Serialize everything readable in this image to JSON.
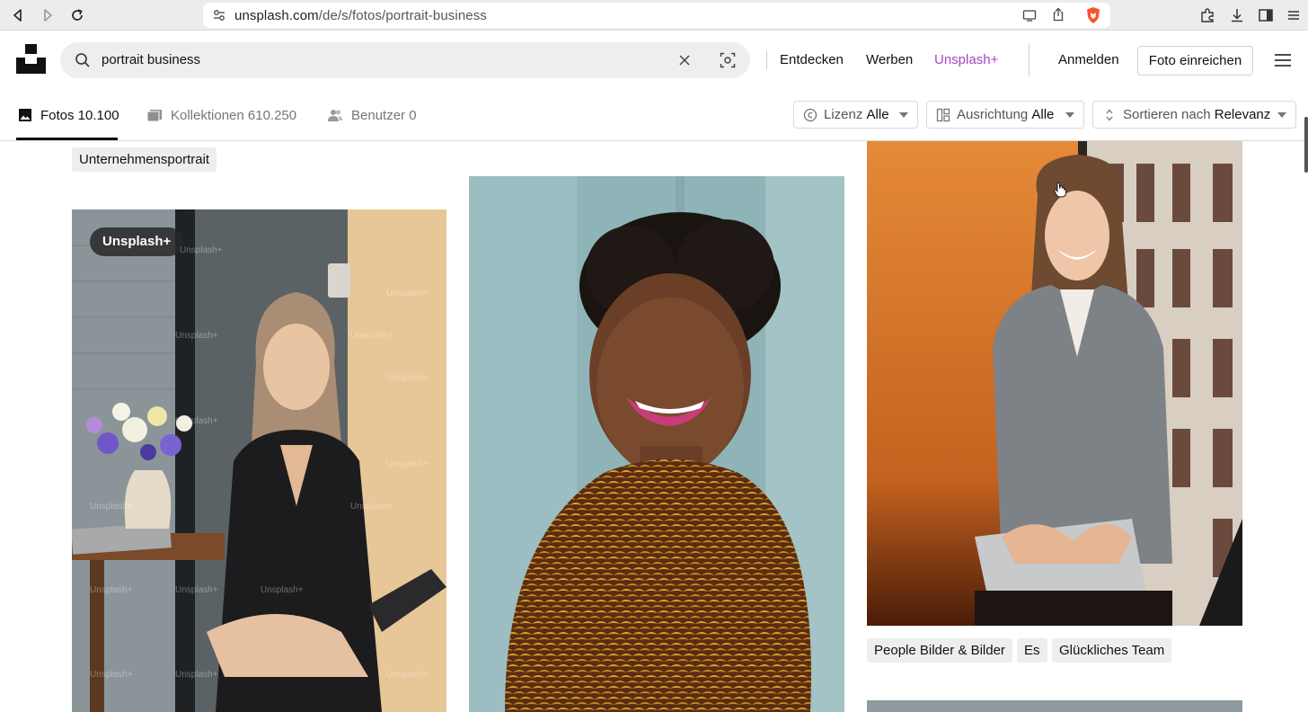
{
  "browser": {
    "url_host": "unsplash.com",
    "url_path": "/de/s/fotos/portrait-business"
  },
  "header": {
    "search_value": "portrait business",
    "nav": {
      "explore": "Entdecken",
      "advertise": "Werben",
      "plus": "Unsplash+",
      "login": "Anmelden",
      "submit": "Foto einreichen"
    }
  },
  "tabs": [
    {
      "label": "Fotos 10.100"
    },
    {
      "label": "Kollektionen 610.250"
    },
    {
      "label": "Benutzer 0"
    }
  ],
  "filters": {
    "license": {
      "label": "Lizenz",
      "value": "Alle"
    },
    "orientation": {
      "label": "Ausrichtung",
      "value": "Alle"
    },
    "sort": {
      "label": "Sortieren nach",
      "value": "Relevanz"
    }
  },
  "content": {
    "top_tag": "Unternehmensportrait",
    "badge": "Unsplash+",
    "watermark": "Unsplash+",
    "col3_tags": [
      "People Bilder & Bilder",
      "Es",
      "Glückliches Team"
    ]
  },
  "colors": {
    "plus_accent": "#a547c4"
  }
}
